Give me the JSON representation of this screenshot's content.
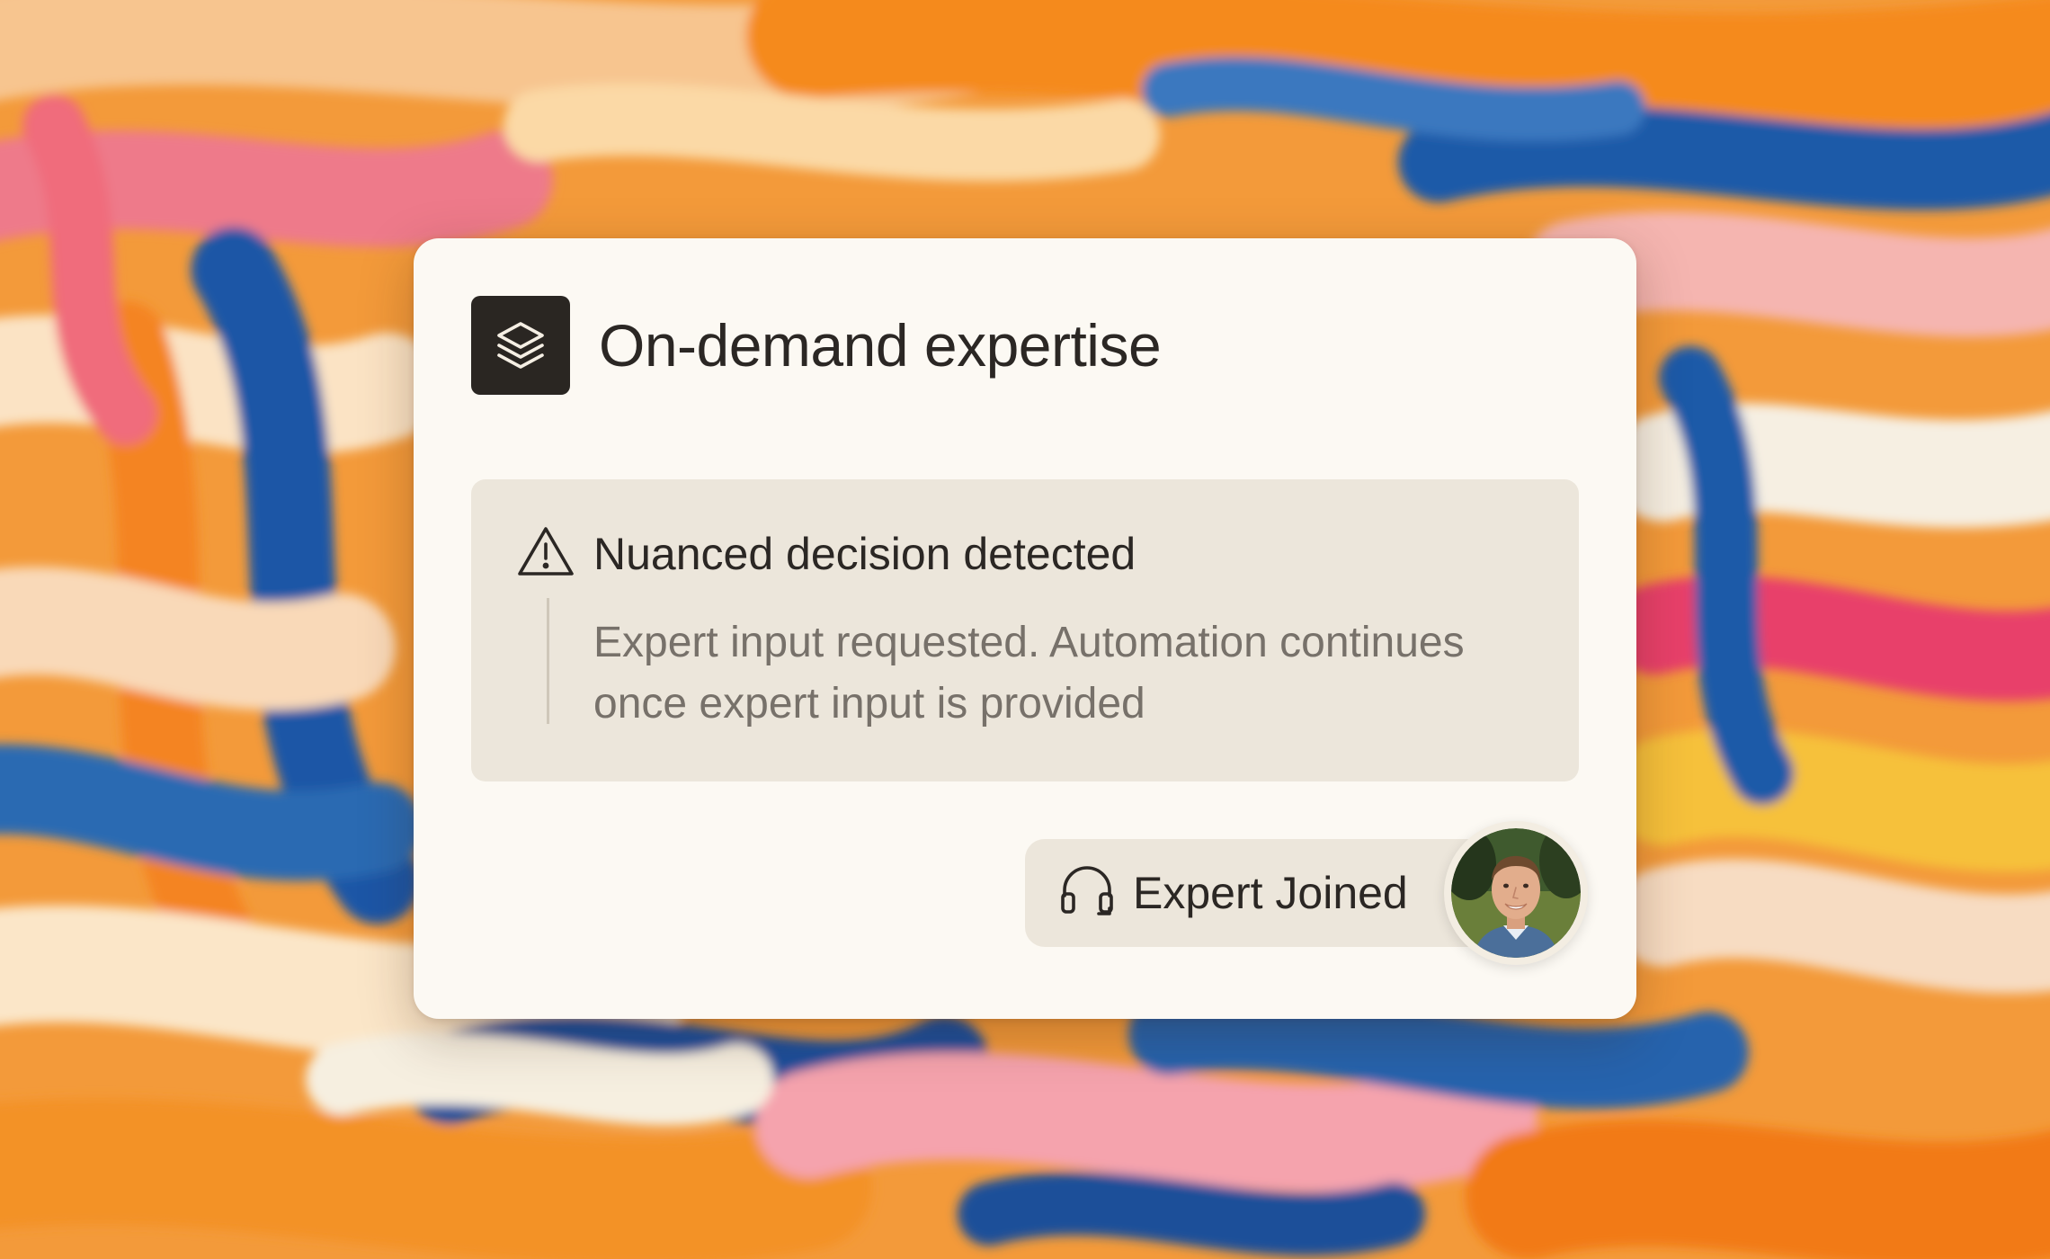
{
  "card": {
    "title": "On-demand expertise",
    "logo_icon": "stacked-layers-icon"
  },
  "alert": {
    "icon": "warning-triangle-icon",
    "title": "Nuanced decision detected",
    "body": "Expert input requested. Automation continues once expert input is provided"
  },
  "expert": {
    "icon": "headset-icon",
    "label": "Expert Joined",
    "avatar": "expert-avatar"
  },
  "colors": {
    "card_bg": "#fcf9f3",
    "panel_bg": "#ece6db",
    "text_dark": "#2b2724",
    "text_muted": "#77716a",
    "logo_tile": "#2a2622"
  }
}
